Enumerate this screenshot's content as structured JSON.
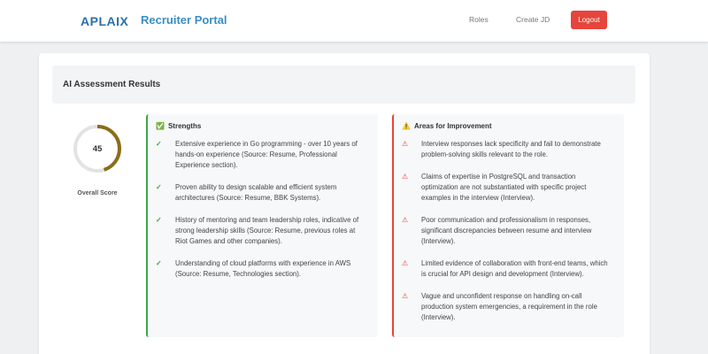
{
  "nav": {
    "logo": "APLAIX",
    "portal_title": "Recruiter Portal",
    "links": [
      "Roles",
      "Create JD"
    ],
    "logout_label": "Logout"
  },
  "assessment": {
    "title": "AI Assessment Results",
    "score": "45",
    "score_fraction": 0.45,
    "score_label": "Overall Score"
  },
  "strengths": {
    "title": "Strengths",
    "icon": "check-square-icon",
    "items": [
      "Extensive experience in Go programming - over 10 years of hands-on experience (Source: Resume, Professional Experience section).",
      "Proven ability to design scalable and efficient system architectures (Source: Resume, BBK Systems).",
      "History of mentoring and team leadership roles, indicative of strong leadership skills (Source: Resume, previous roles at Riot Games and other companies).",
      "Understanding of cloud platforms with experience in AWS (Source: Resume, Technologies section)."
    ]
  },
  "improvements": {
    "title": "Areas for Improvement",
    "icon": "warning-icon",
    "items": [
      "Interview responses lack specificity and fail to demonstrate problem-solving skills relevant to the role.",
      "Claims of expertise in PostgreSQL and transaction optimization are not substantiated with specific project examples in the interview (Interview).",
      "Poor communication and professionalism in responses, significant discrepancies between resume and interview (Interview).",
      "Limited evidence of collaboration with front-end teams, which is crucial for API design and development (Interview).",
      "Vague and unconfident response on handling on-call production system emergencies, a requirement in the role (Interview)."
    ]
  },
  "colors": {
    "score_ring": "#8a6d1a",
    "score_track": "#e3e3e3",
    "strength_accent": "#3ea34c",
    "improve_accent": "#e5453c"
  }
}
